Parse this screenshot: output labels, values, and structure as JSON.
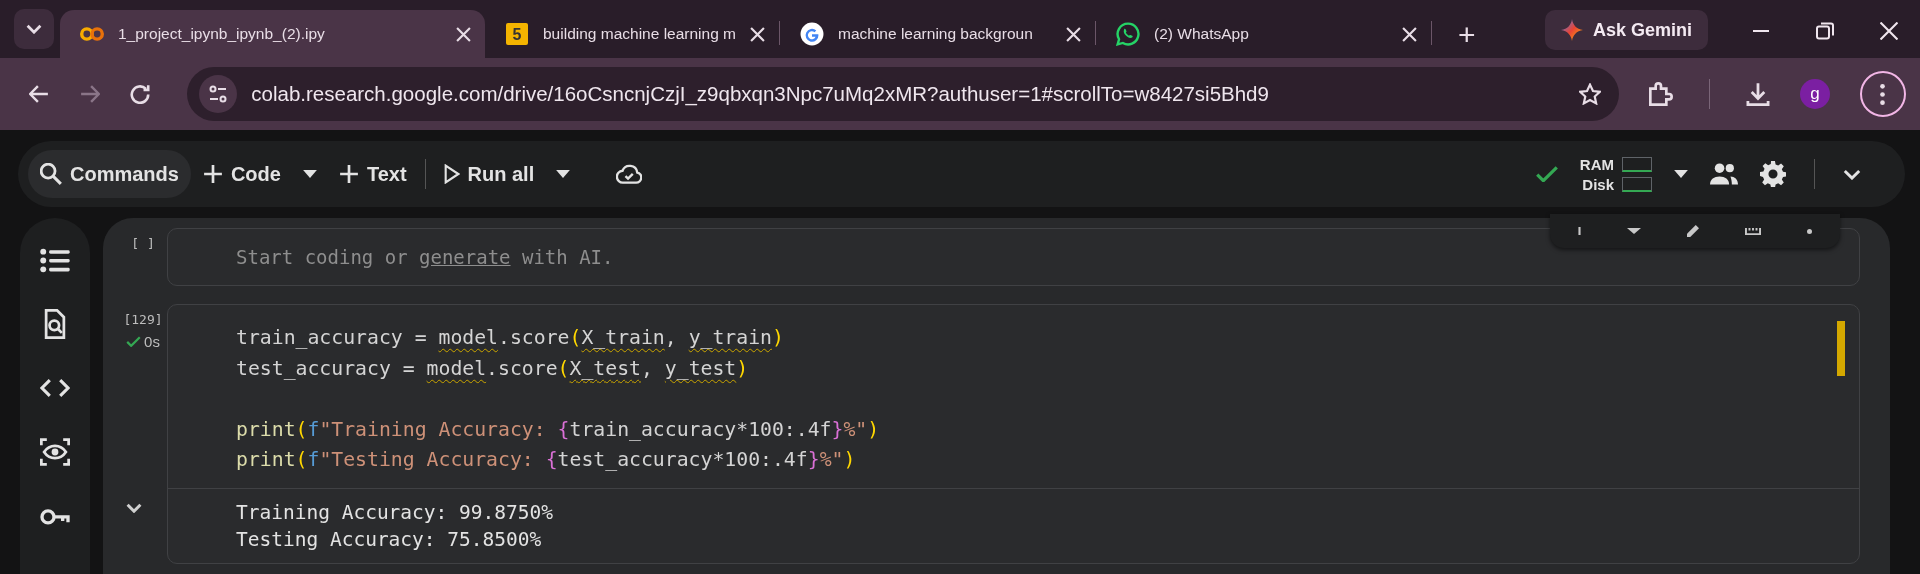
{
  "browser": {
    "tabs": [
      {
        "title": "1_project_ipynb_ipynb_(2).ipy",
        "selected": true
      },
      {
        "title": "building machine learning m",
        "favicon_text": "5",
        "selected": false
      },
      {
        "title": "machine learning backgroun",
        "selected": false
      },
      {
        "title": "(2) WhatsApp",
        "selected": false
      }
    ],
    "new_tab": "+",
    "gemini_button": "Ask Gemini",
    "url": "colab.research.google.com/drive/16oCsncnjCzjI_z9qbxqn3Npc7uMq2xMR?authuser=1#scrollTo=w8427si5Bhd9",
    "profile_initial": "g"
  },
  "colab_toolbar": {
    "buttons": [
      {
        "label": "Commands",
        "kind": "plain"
      },
      {
        "label": "Code",
        "kind": "split"
      },
      {
        "label": "Text",
        "kind": "plain"
      },
      {
        "label": "Run all",
        "kind": "split"
      }
    ],
    "connected": true,
    "resources": [
      "RAM",
      "Disk"
    ]
  },
  "cells": [
    {
      "kind": "empty",
      "execution_count": "[ ]",
      "hint": {
        "before": "Start coding or ",
        "link": "generate",
        "after": " with AI."
      }
    },
    {
      "kind": "code",
      "execution_count": "[129]",
      "duration": "0s",
      "blocks": [
        [
          "train_accuracy = model.score(X_train, y_train)",
          "test_accuracy = model.score(X_test, y_test)"
        ],
        [
          "print(f\"Training Accuracy: {train_accuracy*100:.4f}%\")",
          "print(f\"Testing Accuracy: {test_accuracy*100:.4f}%\")"
        ]
      ],
      "output": [
        "Training Accuracy: 99.8750%",
        "Testing Accuracy: 75.8500%"
      ]
    }
  ]
}
